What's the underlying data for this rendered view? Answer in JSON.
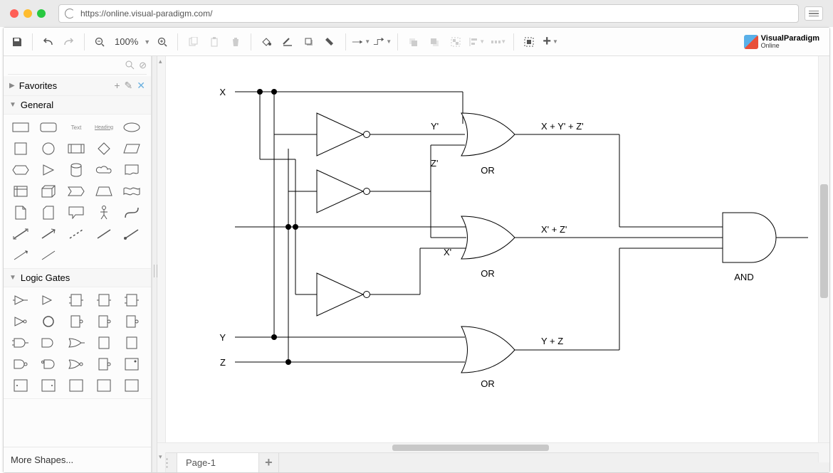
{
  "browser": {
    "url": "https://online.visual-paradigm.com/"
  },
  "toolbar": {
    "zoom_level": "100%"
  },
  "brand": {
    "line1": "VisualParadigm",
    "line2": "Online"
  },
  "side": {
    "favorites_label": "Favorites",
    "general_label": "General",
    "logic_label": "Logic Gates",
    "more_label": "More Shapes..."
  },
  "tabs": {
    "page1": "Page-1"
  },
  "diagram": {
    "inputs": {
      "X": "X",
      "Y": "Y",
      "Z": "Z"
    },
    "wires": {
      "not_y_out": "Y'",
      "not_z_out": "Z'",
      "not_x_out": "X'"
    },
    "gates": {
      "or1": {
        "type": "OR",
        "label": "OR",
        "out": "X + Y' + Z'"
      },
      "or2": {
        "type": "OR",
        "label": "OR",
        "out": "X' + Z'"
      },
      "or3": {
        "type": "OR",
        "label": "OR",
        "out": "Y + Z"
      },
      "and": {
        "type": "AND",
        "label": "AND"
      },
      "not_y": {
        "type": "NOT"
      },
      "not_z": {
        "type": "NOT"
      },
      "not_x": {
        "type": "NOT"
      }
    },
    "expression": "(X + Y' + Z') · (X' + Z') · (Y + Z)"
  }
}
